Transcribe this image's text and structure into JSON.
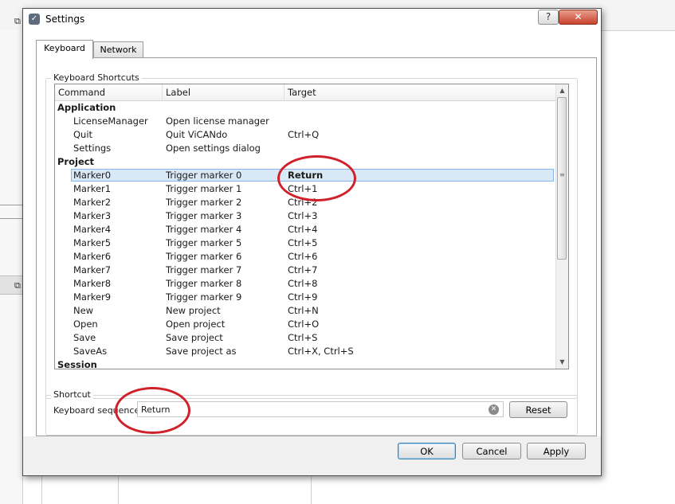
{
  "dialog": {
    "title": "Settings",
    "help_label": "?",
    "close_label": "✕"
  },
  "tabs": [
    {
      "label": "Keyboard",
      "active": true
    },
    {
      "label": "Network",
      "active": false
    }
  ],
  "shortcuts_group": {
    "title": "Keyboard Shortcuts",
    "columns": [
      "Command",
      "Label",
      "Target"
    ],
    "rows": [
      {
        "type": "group",
        "command": "Application"
      },
      {
        "type": "item",
        "command": "LicenseManager",
        "label": "Open license manager",
        "target": ""
      },
      {
        "type": "item",
        "command": "Quit",
        "label": "Quit ViCANdo",
        "target": "Ctrl+Q"
      },
      {
        "type": "item",
        "command": "Settings",
        "label": "Open settings dialog",
        "target": ""
      },
      {
        "type": "group",
        "command": "Project"
      },
      {
        "type": "item",
        "command": "Marker0",
        "label": "Trigger marker 0",
        "target": "Return",
        "selected": true
      },
      {
        "type": "item",
        "command": "Marker1",
        "label": "Trigger marker 1",
        "target": "Ctrl+1"
      },
      {
        "type": "item",
        "command": "Marker2",
        "label": "Trigger marker 2",
        "target": "Ctrl+2"
      },
      {
        "type": "item",
        "command": "Marker3",
        "label": "Trigger marker 3",
        "target": "Ctrl+3"
      },
      {
        "type": "item",
        "command": "Marker4",
        "label": "Trigger marker 4",
        "target": "Ctrl+4"
      },
      {
        "type": "item",
        "command": "Marker5",
        "label": "Trigger marker 5",
        "target": "Ctrl+5"
      },
      {
        "type": "item",
        "command": "Marker6",
        "label": "Trigger marker 6",
        "target": "Ctrl+6"
      },
      {
        "type": "item",
        "command": "Marker7",
        "label": "Trigger marker 7",
        "target": "Ctrl+7"
      },
      {
        "type": "item",
        "command": "Marker8",
        "label": "Trigger marker 8",
        "target": "Ctrl+8"
      },
      {
        "type": "item",
        "command": "Marker9",
        "label": "Trigger marker 9",
        "target": "Ctrl+9"
      },
      {
        "type": "item",
        "command": "New",
        "label": "New project",
        "target": "Ctrl+N"
      },
      {
        "type": "item",
        "command": "Open",
        "label": "Open project",
        "target": "Ctrl+O"
      },
      {
        "type": "item",
        "command": "Save",
        "label": "Save project",
        "target": "Ctrl+S"
      },
      {
        "type": "item",
        "command": "SaveAs",
        "label": "Save project as",
        "target": "Ctrl+X, Ctrl+S"
      },
      {
        "type": "group",
        "command": "Session"
      }
    ]
  },
  "shortcut_group": {
    "title": "Shortcut",
    "sequence_label": "Keyboard sequence:",
    "sequence_value": "Return",
    "reset_label": "Reset"
  },
  "buttons": {
    "ok": "OK",
    "cancel": "Cancel",
    "apply": "Apply"
  },
  "colors": {
    "annotation": "#d0202a",
    "selection": "#d9e8f7",
    "close_button": "#c7422b"
  }
}
